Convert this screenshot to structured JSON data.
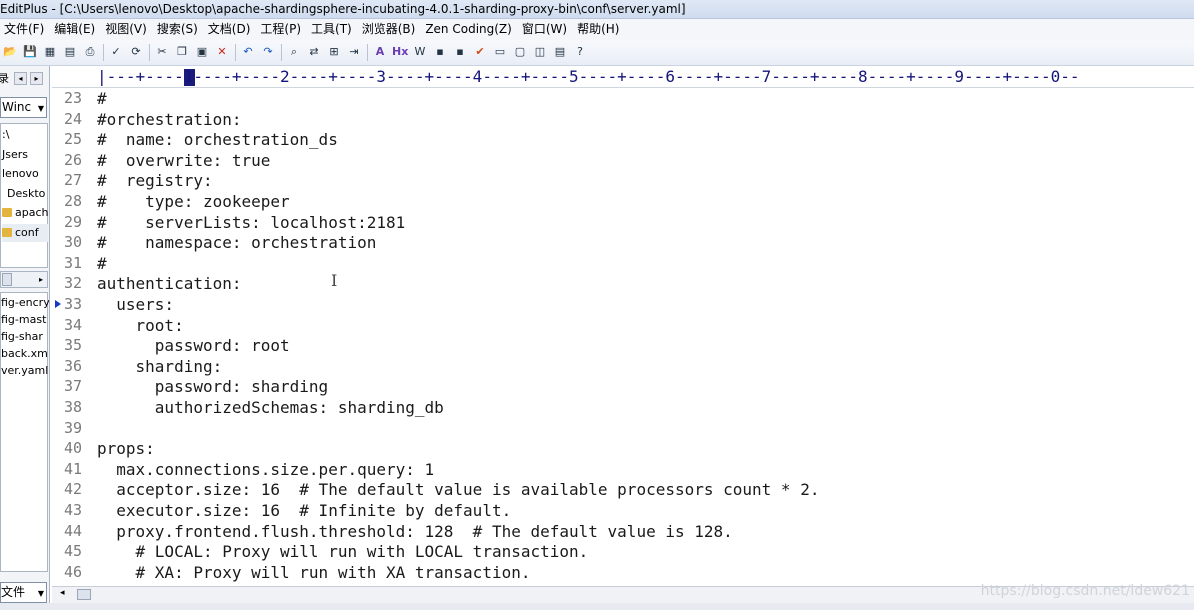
{
  "window": {
    "title": "EditPlus - [C:\\Users\\lenovo\\Desktop\\apache-shardingsphere-incubating-4.0.1-sharding-proxy-bin\\conf\\server.yaml]"
  },
  "menu": {
    "items": [
      {
        "label": "文件(F)"
      },
      {
        "label": "编辑(E)"
      },
      {
        "label": "视图(V)"
      },
      {
        "label": "搜索(S)"
      },
      {
        "label": "文档(D)"
      },
      {
        "label": "工程(P)"
      },
      {
        "label": "工具(T)"
      },
      {
        "label": "浏览器(B)"
      },
      {
        "label": "Zen Coding(Z)"
      },
      {
        "label": "窗口(W)"
      },
      {
        "label": "帮助(H)"
      }
    ]
  },
  "toolbar": {
    "icons": [
      "open-icon",
      "save-icon",
      "save-all-icon",
      "print-preview-icon",
      "print-icon",
      "spellcheck-icon",
      "refresh-icon",
      "cut-icon",
      "copy-icon",
      "paste-icon",
      "delete-icon",
      "undo-icon",
      "redo-icon",
      "find-icon",
      "replace-icon",
      "find-in-files-icon",
      "goto-line-icon",
      "font-size-icon",
      "hex-icon",
      "word-wrap-icon",
      "line-number-icon",
      "column-marker-icon",
      "check-icon",
      "window-icon",
      "fullscreen-icon",
      "split-icon",
      "output-icon",
      "help-icon"
    ],
    "labels": {
      "font": "A",
      "hex": "Hx",
      "wrap": "W",
      "check": "✔",
      "help": "?"
    }
  },
  "sidebar": {
    "tab_label": "录",
    "drive": "Winc",
    "tree": [
      {
        "label": ":\\"
      },
      {
        "label": "Jsers"
      },
      {
        "label": "lenovo"
      },
      {
        "label": "Deskto"
      },
      {
        "label": "apach"
      },
      {
        "label": "conf"
      }
    ],
    "files": [
      {
        "label": "fig-encry"
      },
      {
        "label": "fig-mast"
      },
      {
        "label": "fig-shar"
      },
      {
        "label": "back.xm"
      },
      {
        "label": "ver.yaml"
      }
    ],
    "filter": "文件"
  },
  "ruler": {
    "text": "|---+----1----+----2----+----3----+----4----+----5----+----6----+----7----+----8----+----9----+----0--"
  },
  "editor": {
    "current_line": 33,
    "lines": [
      {
        "num": "23",
        "text": "#"
      },
      {
        "num": "24",
        "text": "#orchestration:"
      },
      {
        "num": "25",
        "text": "#  name: orchestration_ds"
      },
      {
        "num": "26",
        "text": "#  overwrite: true"
      },
      {
        "num": "27",
        "text": "#  registry:"
      },
      {
        "num": "28",
        "text": "#    type: zookeeper"
      },
      {
        "num": "29",
        "text": "#    serverLists: localhost:2181"
      },
      {
        "num": "30",
        "text": "#    namespace: orchestration"
      },
      {
        "num": "31",
        "text": "#"
      },
      {
        "num": "32",
        "text": "authentication:"
      },
      {
        "num": "33",
        "text": "  users:"
      },
      {
        "num": "34",
        "text": "    root:"
      },
      {
        "num": "35",
        "text": "      password: root"
      },
      {
        "num": "36",
        "text": "    sharding:"
      },
      {
        "num": "37",
        "text": "      password: sharding"
      },
      {
        "num": "38",
        "text": "      authorizedSchemas: sharding_db"
      },
      {
        "num": "39",
        "text": ""
      },
      {
        "num": "40",
        "text": "props:"
      },
      {
        "num": "41",
        "text": "  max.connections.size.per.query: 1"
      },
      {
        "num": "42",
        "text": "  acceptor.size: 16  # The default value is available processors count * 2."
      },
      {
        "num": "43",
        "text": "  executor.size: 16  # Infinite by default."
      },
      {
        "num": "44",
        "text": "  proxy.frontend.flush.threshold: 128  # The default value is 128."
      },
      {
        "num": "45",
        "text": "    # LOCAL: Proxy will run with LOCAL transaction."
      },
      {
        "num": "46",
        "text": "    # XA: Proxy will run with XA transaction."
      }
    ]
  },
  "watermark": "https://blog.csdn.net/ldew621"
}
